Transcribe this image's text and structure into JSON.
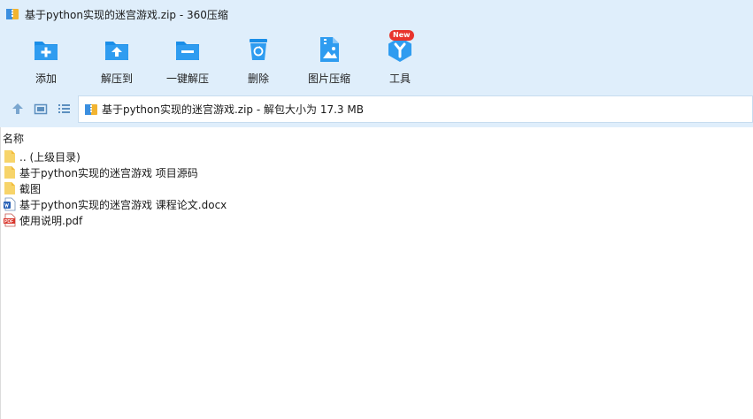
{
  "window": {
    "title": "基于python实现的迷宫游戏.zip - 360压缩"
  },
  "toolbar": {
    "items": [
      {
        "label": "添加",
        "icon": "add-icon"
      },
      {
        "label": "解压到",
        "icon": "extract-to-icon"
      },
      {
        "label": "一键解压",
        "icon": "one-click-extract-icon"
      },
      {
        "label": "删除",
        "icon": "delete-icon"
      },
      {
        "label": "图片压缩",
        "icon": "image-compress-icon"
      },
      {
        "label": "工具",
        "icon": "tools-icon",
        "badge": "New"
      }
    ]
  },
  "address": {
    "text": "基于python实现的迷宫游戏.zip - 解包大小为 17.3 MB"
  },
  "filelist": {
    "header": "名称",
    "rows": [
      {
        "name": ".. (上级目录)",
        "type": "folder"
      },
      {
        "name": "基于python实现的迷宫游戏 项目源码",
        "type": "folder"
      },
      {
        "name": "截图",
        "type": "folder"
      },
      {
        "name": "基于python实现的迷宫游戏 课程论文.docx",
        "type": "docx"
      },
      {
        "name": "使用说明.pdf",
        "type": "pdf"
      }
    ]
  },
  "colors": {
    "accent": "#1a8ee8",
    "chrome_bg": "#dfeefb",
    "folder": "#f7d46a",
    "pdf": "#d9362c",
    "badge": "#e8342d"
  }
}
